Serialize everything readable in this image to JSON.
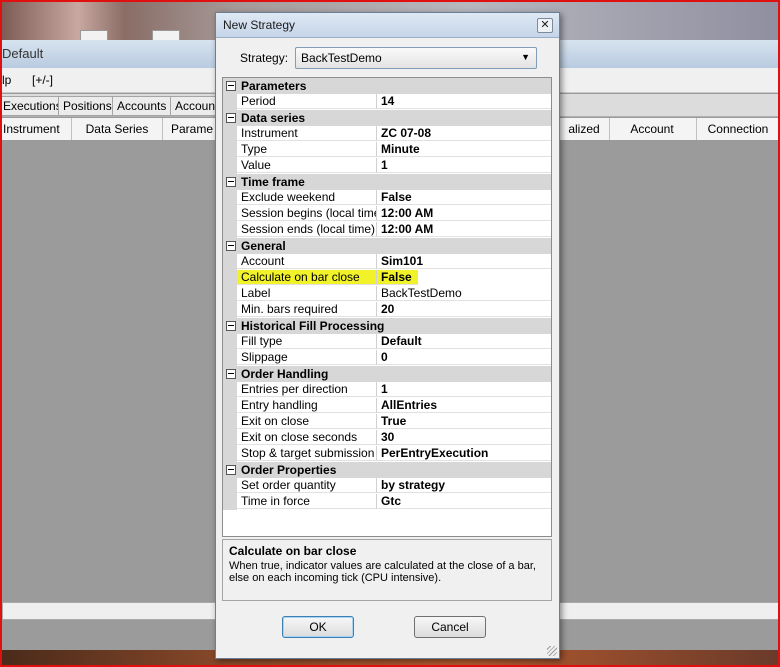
{
  "background_window": {
    "title": "Default",
    "menu": [
      "lp",
      "[+/-]"
    ],
    "tabs": [
      "Executions",
      "Positions",
      "Accounts",
      "Account"
    ],
    "columns_left": [
      "Instrument",
      "Data Series",
      "Parame"
    ],
    "columns_right": [
      "alized",
      "Account",
      "Connection"
    ]
  },
  "dialog": {
    "title": "New Strategy",
    "close_glyph": "✕",
    "strategy_label": "Strategy:",
    "strategy_value": "BackTestDemo",
    "sections": [
      {
        "name": "Parameters",
        "props": [
          {
            "name": "Period",
            "value": "14"
          }
        ]
      },
      {
        "name": "Data series",
        "props": [
          {
            "name": "Instrument",
            "value": "ZC 07-08"
          },
          {
            "name": "Type",
            "value": "Minute"
          },
          {
            "name": "Value",
            "value": "1"
          }
        ]
      },
      {
        "name": "Time frame",
        "props": [
          {
            "name": "Exclude weekend",
            "value": "False"
          },
          {
            "name": "Session begins (local time)",
            "value": "12:00 AM"
          },
          {
            "name": "Session ends (local time)",
            "value": "12:00 AM"
          }
        ]
      },
      {
        "name": "General",
        "props": [
          {
            "name": "Account",
            "value": "Sim101"
          },
          {
            "name": "Calculate on bar close",
            "value": "False",
            "highlight": true
          },
          {
            "name": "Label",
            "value": "BackTestDemo",
            "normal": true
          },
          {
            "name": "Min. bars required",
            "value": "20"
          }
        ]
      },
      {
        "name": "Historical Fill Processing",
        "props": [
          {
            "name": "Fill type",
            "value": "Default"
          },
          {
            "name": "Slippage",
            "value": "0"
          }
        ]
      },
      {
        "name": "Order Handling",
        "props": [
          {
            "name": "Entries per direction",
            "value": "1"
          },
          {
            "name": "Entry handling",
            "value": "AllEntries"
          },
          {
            "name": "Exit on close",
            "value": "True"
          },
          {
            "name": "Exit on close seconds",
            "value": "30"
          },
          {
            "name": "Stop & target submission",
            "value": "PerEntryExecution"
          }
        ]
      },
      {
        "name": "Order Properties",
        "props": [
          {
            "name": "Set order quantity",
            "value": "by strategy"
          },
          {
            "name": "Time in force",
            "value": "Gtc"
          }
        ]
      }
    ],
    "help_title": "Calculate on bar close",
    "help_text": "When true, indicator values are calculated at the close of a bar, else on each incoming tick (CPU intensive).",
    "ok_label": "OK",
    "cancel_label": "Cancel"
  },
  "colors": {
    "highlight": "#f2f22a",
    "frame": "#e01010",
    "category_bg": "#d7d7d7"
  }
}
